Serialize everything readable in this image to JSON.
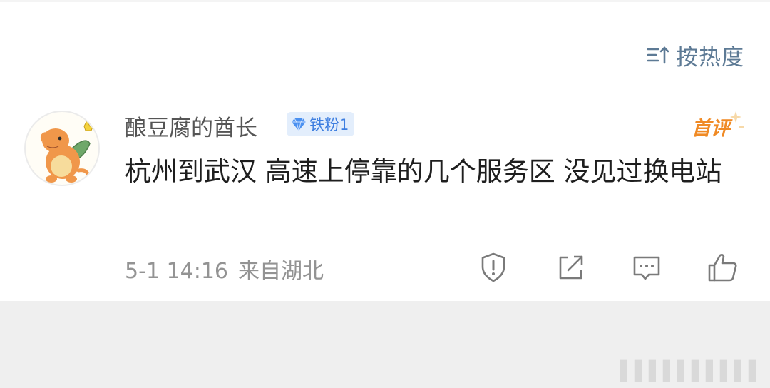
{
  "sort": {
    "label": "按热度",
    "icon": "sort-icon"
  },
  "comment": {
    "username": "酿豆腐的酋长",
    "fan_badge": {
      "label": "铁粉1",
      "icon": "diamond-icon",
      "color": "#3d7ee0"
    },
    "first_badge": "首评",
    "text": "杭州到武汉 高速上停靠的几个服务区 没见过换电站",
    "time": "5-1 14:16",
    "location": "来自湖北",
    "actions": [
      {
        "name": "report",
        "icon": "shield-exclamation-icon"
      },
      {
        "name": "share",
        "icon": "share-icon"
      },
      {
        "name": "reply",
        "icon": "comment-icon"
      },
      {
        "name": "like",
        "icon": "thumbs-up-icon"
      }
    ]
  },
  "colors": {
    "accent_blue": "#5d7a95",
    "text_dark": "#1e1e1e",
    "meta_grey": "#939393",
    "first_orange": "#f08a24"
  }
}
